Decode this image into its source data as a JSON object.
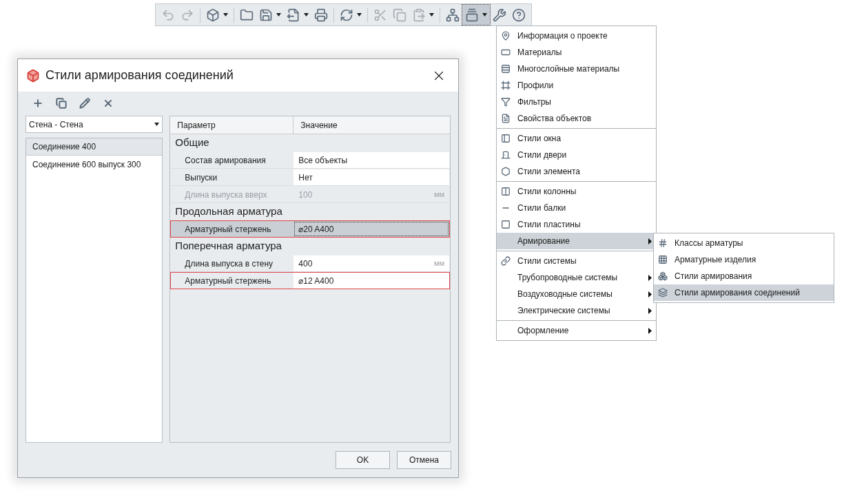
{
  "toolbar": [
    {
      "kind": "button",
      "disabled": true,
      "dropdown": false,
      "selected": false
    },
    {
      "kind": "button",
      "disabled": true,
      "dropdown": false,
      "selected": false
    },
    {
      "kind": "separator"
    },
    {
      "kind": "button",
      "disabled": false,
      "dropdown": true,
      "selected": false
    },
    {
      "kind": "separator"
    },
    {
      "kind": "button",
      "disabled": false,
      "dropdown": false,
      "selected": false
    },
    {
      "kind": "button",
      "disabled": false,
      "dropdown": true,
      "selected": false
    },
    {
      "kind": "button",
      "disabled": false,
      "dropdown": true,
      "selected": false
    },
    {
      "kind": "button",
      "disabled": false,
      "dropdown": false,
      "selected": false
    },
    {
      "kind": "separator"
    },
    {
      "kind": "button",
      "disabled": false,
      "dropdown": true,
      "selected": false
    },
    {
      "kind": "separator"
    },
    {
      "kind": "button",
      "disabled": true,
      "dropdown": false,
      "selected": false
    },
    {
      "kind": "button",
      "disabled": true,
      "dropdown": false,
      "selected": false
    },
    {
      "kind": "button",
      "disabled": true,
      "dropdown": true,
      "selected": false
    },
    {
      "kind": "separator"
    },
    {
      "kind": "button",
      "disabled": false,
      "dropdown": false,
      "selected": false
    },
    {
      "kind": "button",
      "disabled": false,
      "dropdown": true,
      "selected": true
    },
    {
      "kind": "button",
      "disabled": false,
      "dropdown": false,
      "selected": false
    },
    {
      "kind": "button",
      "disabled": false,
      "dropdown": false,
      "selected": false
    }
  ],
  "menu": {
    "groups": [
      [
        {
          "label": "Информация о проекте",
          "submenu": false,
          "highlighted": false
        },
        {
          "label": "Материалы",
          "submenu": false,
          "highlighted": false
        },
        {
          "label": "Многослойные материалы",
          "submenu": false,
          "highlighted": false
        },
        {
          "label": "Профили",
          "submenu": false,
          "highlighted": false
        },
        {
          "label": "Фильтры",
          "submenu": false,
          "highlighted": false
        },
        {
          "label": "Свойства объектов",
          "submenu": false,
          "highlighted": false
        }
      ],
      [
        {
          "label": "Стили окна",
          "submenu": false,
          "highlighted": false
        },
        {
          "label": "Стили двери",
          "submenu": false,
          "highlighted": false
        },
        {
          "label": "Стили элемента",
          "submenu": false,
          "highlighted": false
        }
      ],
      [
        {
          "label": "Стили колонны",
          "submenu": false,
          "highlighted": false
        },
        {
          "label": "Стили балки",
          "submenu": false,
          "highlighted": false
        },
        {
          "label": "Стили пластины",
          "submenu": false,
          "highlighted": false
        },
        {
          "label": "Армирование",
          "submenu": true,
          "highlighted": true
        }
      ],
      [
        {
          "label": "Стили системы",
          "submenu": false,
          "highlighted": false
        },
        {
          "label": "Трубопроводные системы",
          "submenu": true,
          "highlighted": false
        },
        {
          "label": "Воздуховодные системы",
          "submenu": true,
          "highlighted": false
        },
        {
          "label": "Электрические системы",
          "submenu": true,
          "highlighted": false
        }
      ],
      [
        {
          "label": "Оформление",
          "submenu": true,
          "highlighted": false
        }
      ]
    ],
    "submenu": [
      {
        "label": "Классы арматуры",
        "selected": false
      },
      {
        "label": "Арматурные изделия",
        "selected": false
      },
      {
        "label": "Стили армирования",
        "selected": false
      },
      {
        "label": "Стили армирования соединений",
        "selected": true
      }
    ]
  },
  "dialog": {
    "title": "Стили армирования соединений",
    "type_select": {
      "value": "Стена - Стена"
    },
    "styles": [
      {
        "label": "Соединение 400",
        "selected": true
      },
      {
        "label": "Соединение 600 выпуск 300",
        "selected": false
      }
    ],
    "table": {
      "columns": [
        "Параметр",
        "Значение"
      ],
      "rows": [
        {
          "kind": "section",
          "label": "Общие"
        },
        {
          "kind": "param",
          "label": "Состав армирования",
          "value": "Все объекты",
          "disabled": false,
          "selected": false,
          "flagged": false
        },
        {
          "kind": "param",
          "label": "Выпуски",
          "value": "Нет",
          "disabled": false,
          "selected": false,
          "flagged": false
        },
        {
          "kind": "param",
          "label": "Длина выпуска вверх",
          "value": "100",
          "unit": "мм",
          "disabled": true,
          "selected": false,
          "flagged": false
        },
        {
          "kind": "section",
          "label": "Продольная арматура"
        },
        {
          "kind": "param",
          "label": "Арматурный стержень",
          "value": "⌀20 A400",
          "disabled": false,
          "selected": true,
          "flagged": true
        },
        {
          "kind": "section",
          "label": "Поперечная арматура"
        },
        {
          "kind": "param",
          "label": "Длина выпуска в стену",
          "value": "400",
          "unit": "мм",
          "disabled": false,
          "selected": false,
          "flagged": false
        },
        {
          "kind": "param",
          "label": "Арматурный стержень",
          "value": "⌀12 A400",
          "disabled": false,
          "selected": false,
          "flagged": true
        }
      ]
    },
    "buttons": [
      "OK",
      "Отмена"
    ]
  }
}
